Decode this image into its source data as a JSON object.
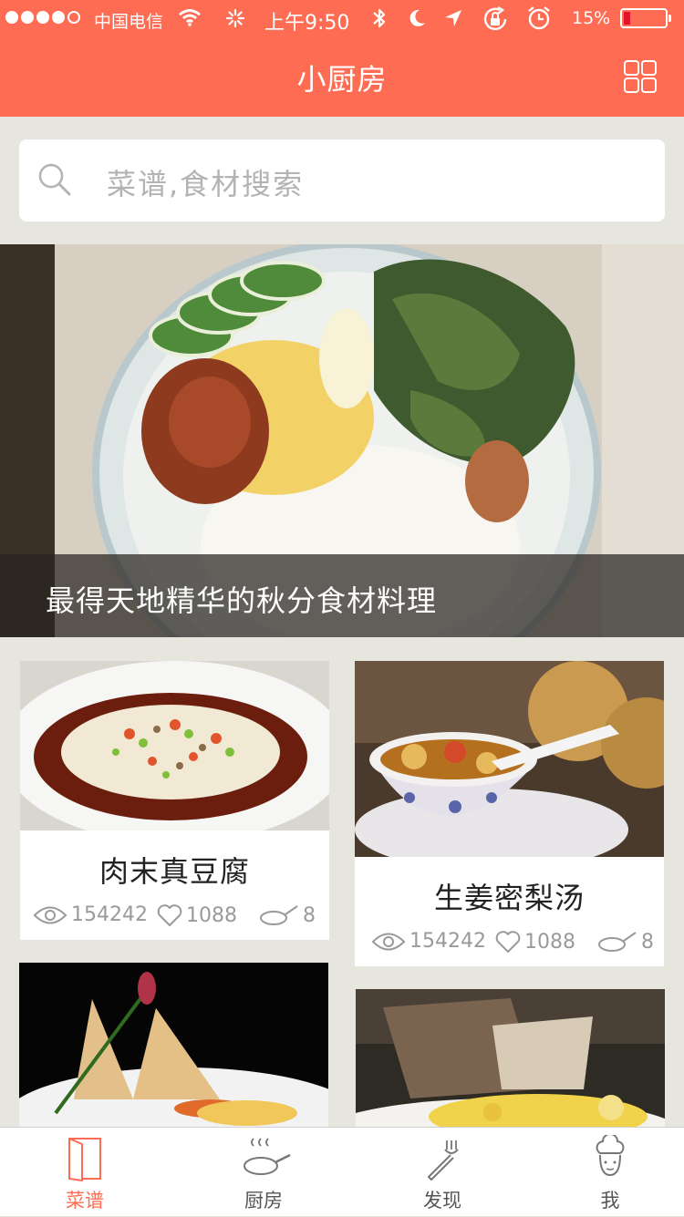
{
  "status_bar": {
    "carrier": "中国电信",
    "time": "上午9:50",
    "battery_percent": "15%",
    "battery_level": 0.15,
    "signal_bars_filled": 4,
    "icons": [
      "wifi-icon",
      "activity-icon",
      "bluetooth-icon",
      "moon-icon",
      "location-icon",
      "rotation-lock-icon",
      "alarm-icon"
    ]
  },
  "header": {
    "title": "小厨房",
    "grid_icon": "grid-icon"
  },
  "search": {
    "placeholder": "菜谱,食材搜索",
    "icon": "search-icon"
  },
  "banner": {
    "caption": "最得天地精华的秋分食材料理"
  },
  "recipes": [
    {
      "name": "肉末真豆腐",
      "views": "154242",
      "likes": "1088",
      "dishes": "8"
    },
    {
      "name": "生姜密梨汤",
      "views": "154242",
      "likes": "1088",
      "dishes": "8"
    },
    {
      "name": "",
      "views": "",
      "likes": "",
      "dishes": ""
    },
    {
      "name": "",
      "views": "",
      "likes": "",
      "dishes": ""
    }
  ],
  "tabs": [
    {
      "label": "菜谱",
      "icon": "book-icon",
      "active": true
    },
    {
      "label": "厨房",
      "icon": "pan-icon",
      "active": false
    },
    {
      "label": "发现",
      "icon": "fork-icon",
      "active": false
    },
    {
      "label": "我",
      "icon": "chef-icon",
      "active": false
    }
  ],
  "colors": {
    "brand": "#fe6d53",
    "background": "#e6e5de",
    "battery_low": "#e0142b"
  }
}
